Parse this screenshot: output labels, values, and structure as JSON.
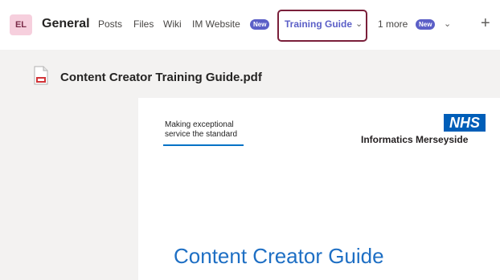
{
  "header": {
    "avatar_initials": "EL",
    "channel_title": "General",
    "tabs": [
      {
        "label": "Posts"
      },
      {
        "label": "Files"
      },
      {
        "label": "Wiki"
      },
      {
        "label": "IM Website",
        "badge": "New"
      },
      {
        "label": "Training Guide",
        "active": true
      },
      {
        "label": "1 more",
        "badge": "New"
      }
    ],
    "add_tab_icon": "plus-icon",
    "accent_color": "#5b5fc7",
    "highlight_color": "#7a1f3a"
  },
  "file": {
    "name": "Content Creator Training Guide.pdf",
    "icon": "pdf-file-icon"
  },
  "document": {
    "tagline_line1": "Making exceptional",
    "tagline_line2": "service the standard",
    "logo_text": "NHS",
    "organisation": "Informatics Merseyside",
    "title": "Content Creator Guide",
    "title_color": "#1e6fc4"
  }
}
